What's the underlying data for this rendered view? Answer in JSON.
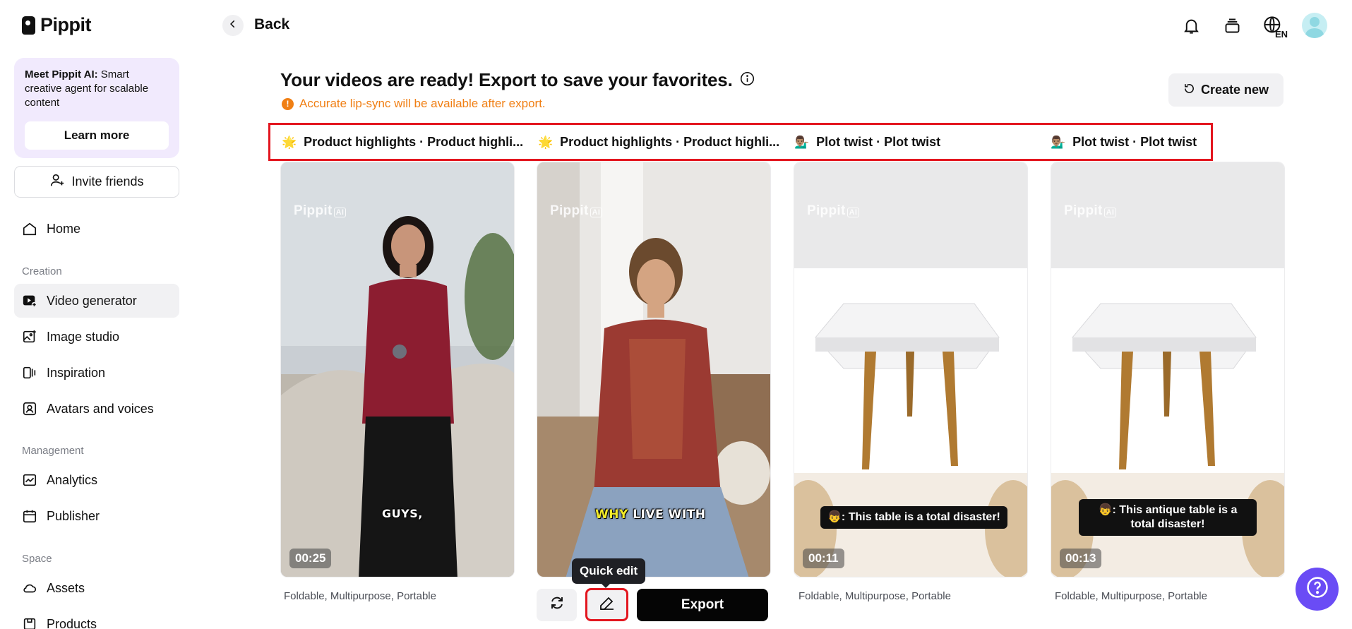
{
  "app": {
    "name": "Pippit"
  },
  "sidebar": {
    "promo": {
      "title": "Meet Pippit AI:",
      "body": " Smart creative agent for scalable content",
      "button": "Learn more"
    },
    "invite": "Invite friends",
    "home": "Home",
    "sections": {
      "creation": "Creation",
      "management": "Management",
      "space": "Space"
    },
    "creation_items": [
      "Video generator",
      "Image studio",
      "Inspiration",
      "Avatars and voices"
    ],
    "management_items": [
      "Analytics",
      "Publisher"
    ],
    "space_items": [
      "Assets",
      "Products"
    ]
  },
  "topbar": {
    "back": "Back",
    "lang": "EN"
  },
  "main": {
    "headline": "Your videos are ready! Export to save your favorites.",
    "warning": "Accurate lip-sync will be available after export.",
    "create_new": "Create new",
    "tabs": [
      {
        "emoji": "🌟",
        "label": "Product highlights · Product highli..."
      },
      {
        "emoji": "🌟",
        "label": "Product highlights · Product highli..."
      },
      {
        "emoji": "💁🏽‍♂️",
        "label": "Plot twist · Plot twist"
      },
      {
        "emoji": "💁🏽‍♂️",
        "label": "Plot twist · Plot twist"
      }
    ],
    "cards": [
      {
        "watermark": "Pippit",
        "watermark_badge": "AI",
        "duration": "00:25",
        "caption": "GUYS,",
        "desc": "Foldable, Multipurpose, Portable"
      },
      {
        "watermark": "Pippit",
        "watermark_badge": "AI",
        "caption_highlight": "WHY",
        "caption": " LIVE WITH"
      },
      {
        "watermark": "Pippit",
        "watermark_badge": "AI",
        "duration": "00:11",
        "caption": "👦: This table is a total disaster!",
        "desc": "Foldable, Multipurpose, Portable"
      },
      {
        "watermark": "Pippit",
        "watermark_badge": "AI",
        "duration": "00:13",
        "caption": "👦: This antique table is a total disaster!",
        "desc": "Foldable, Multipurpose, Portable"
      }
    ],
    "actions": {
      "tooltip": "Quick edit",
      "export": "Export"
    }
  },
  "colors": {
    "accent": "#6a4cf5",
    "warning": "#f07f14",
    "highlight_border": "#e3161f",
    "promo_bg": "#f1eafd"
  }
}
